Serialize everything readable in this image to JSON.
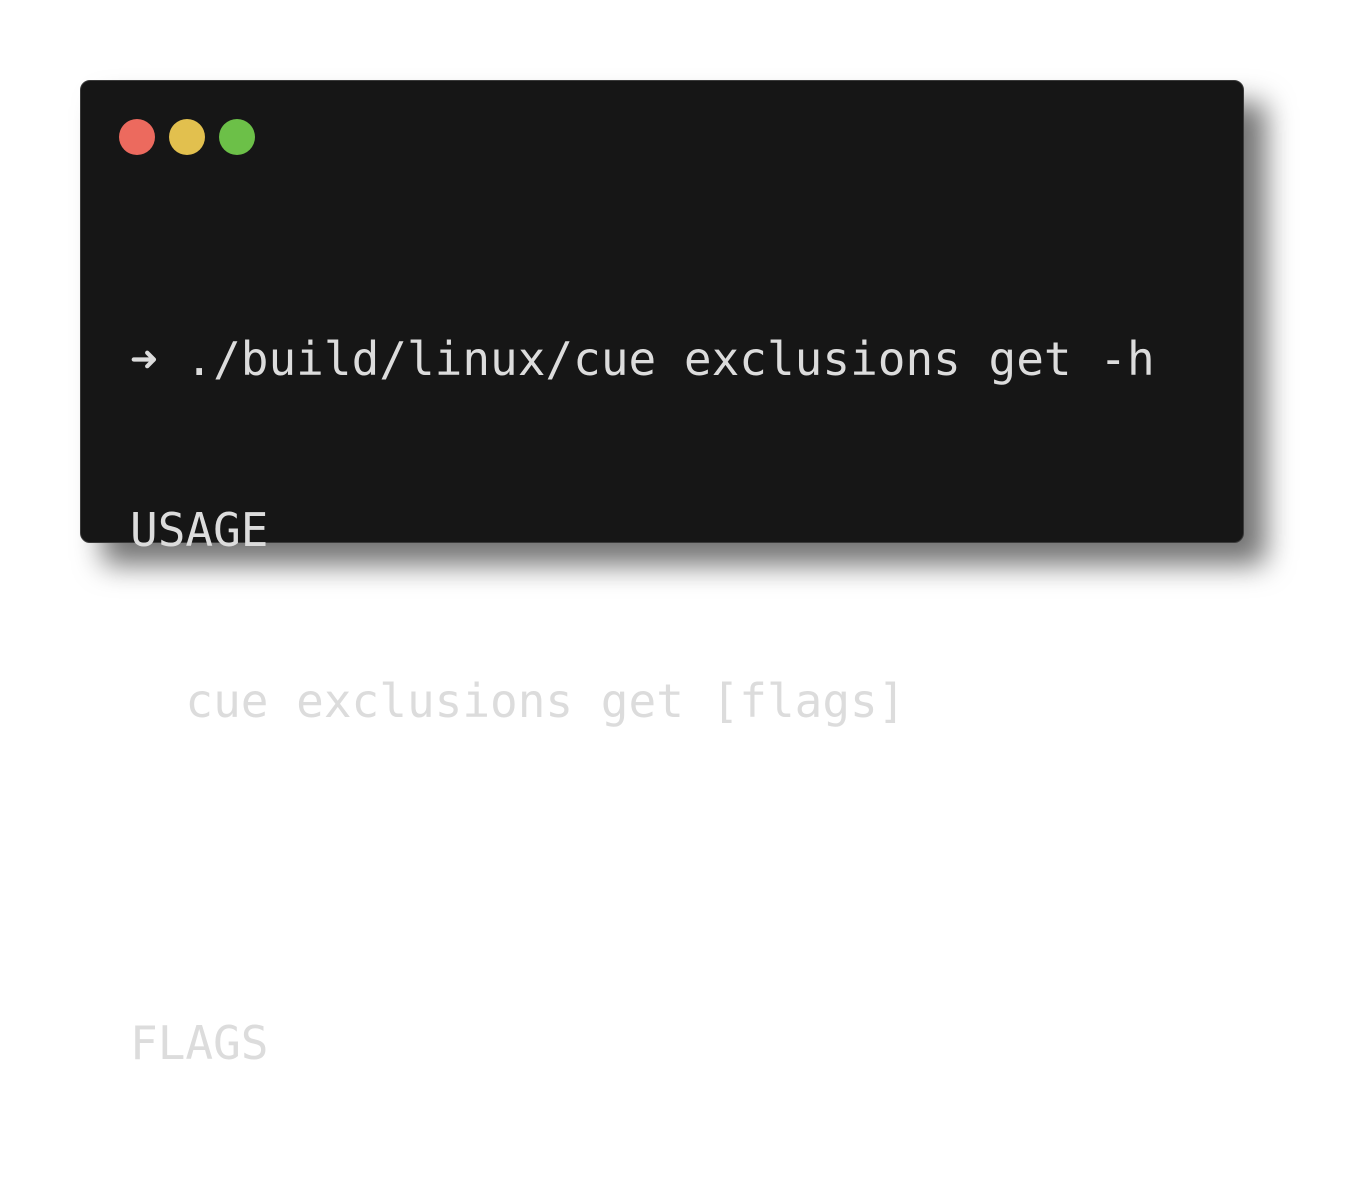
{
  "window": {
    "controls": [
      {
        "name": "close",
        "color": "#ec6a5e"
      },
      {
        "name": "minimize",
        "color": "#e2c04e"
      },
      {
        "name": "maximize",
        "color": "#6cc048"
      }
    ]
  },
  "terminal": {
    "prompt_symbol": "➜",
    "command": "./build/linux/cue exclusions get -h",
    "lines": [
      "USAGE",
      "  cue exclusions get [flags]",
      "",
      "FLAGS"
    ]
  }
}
